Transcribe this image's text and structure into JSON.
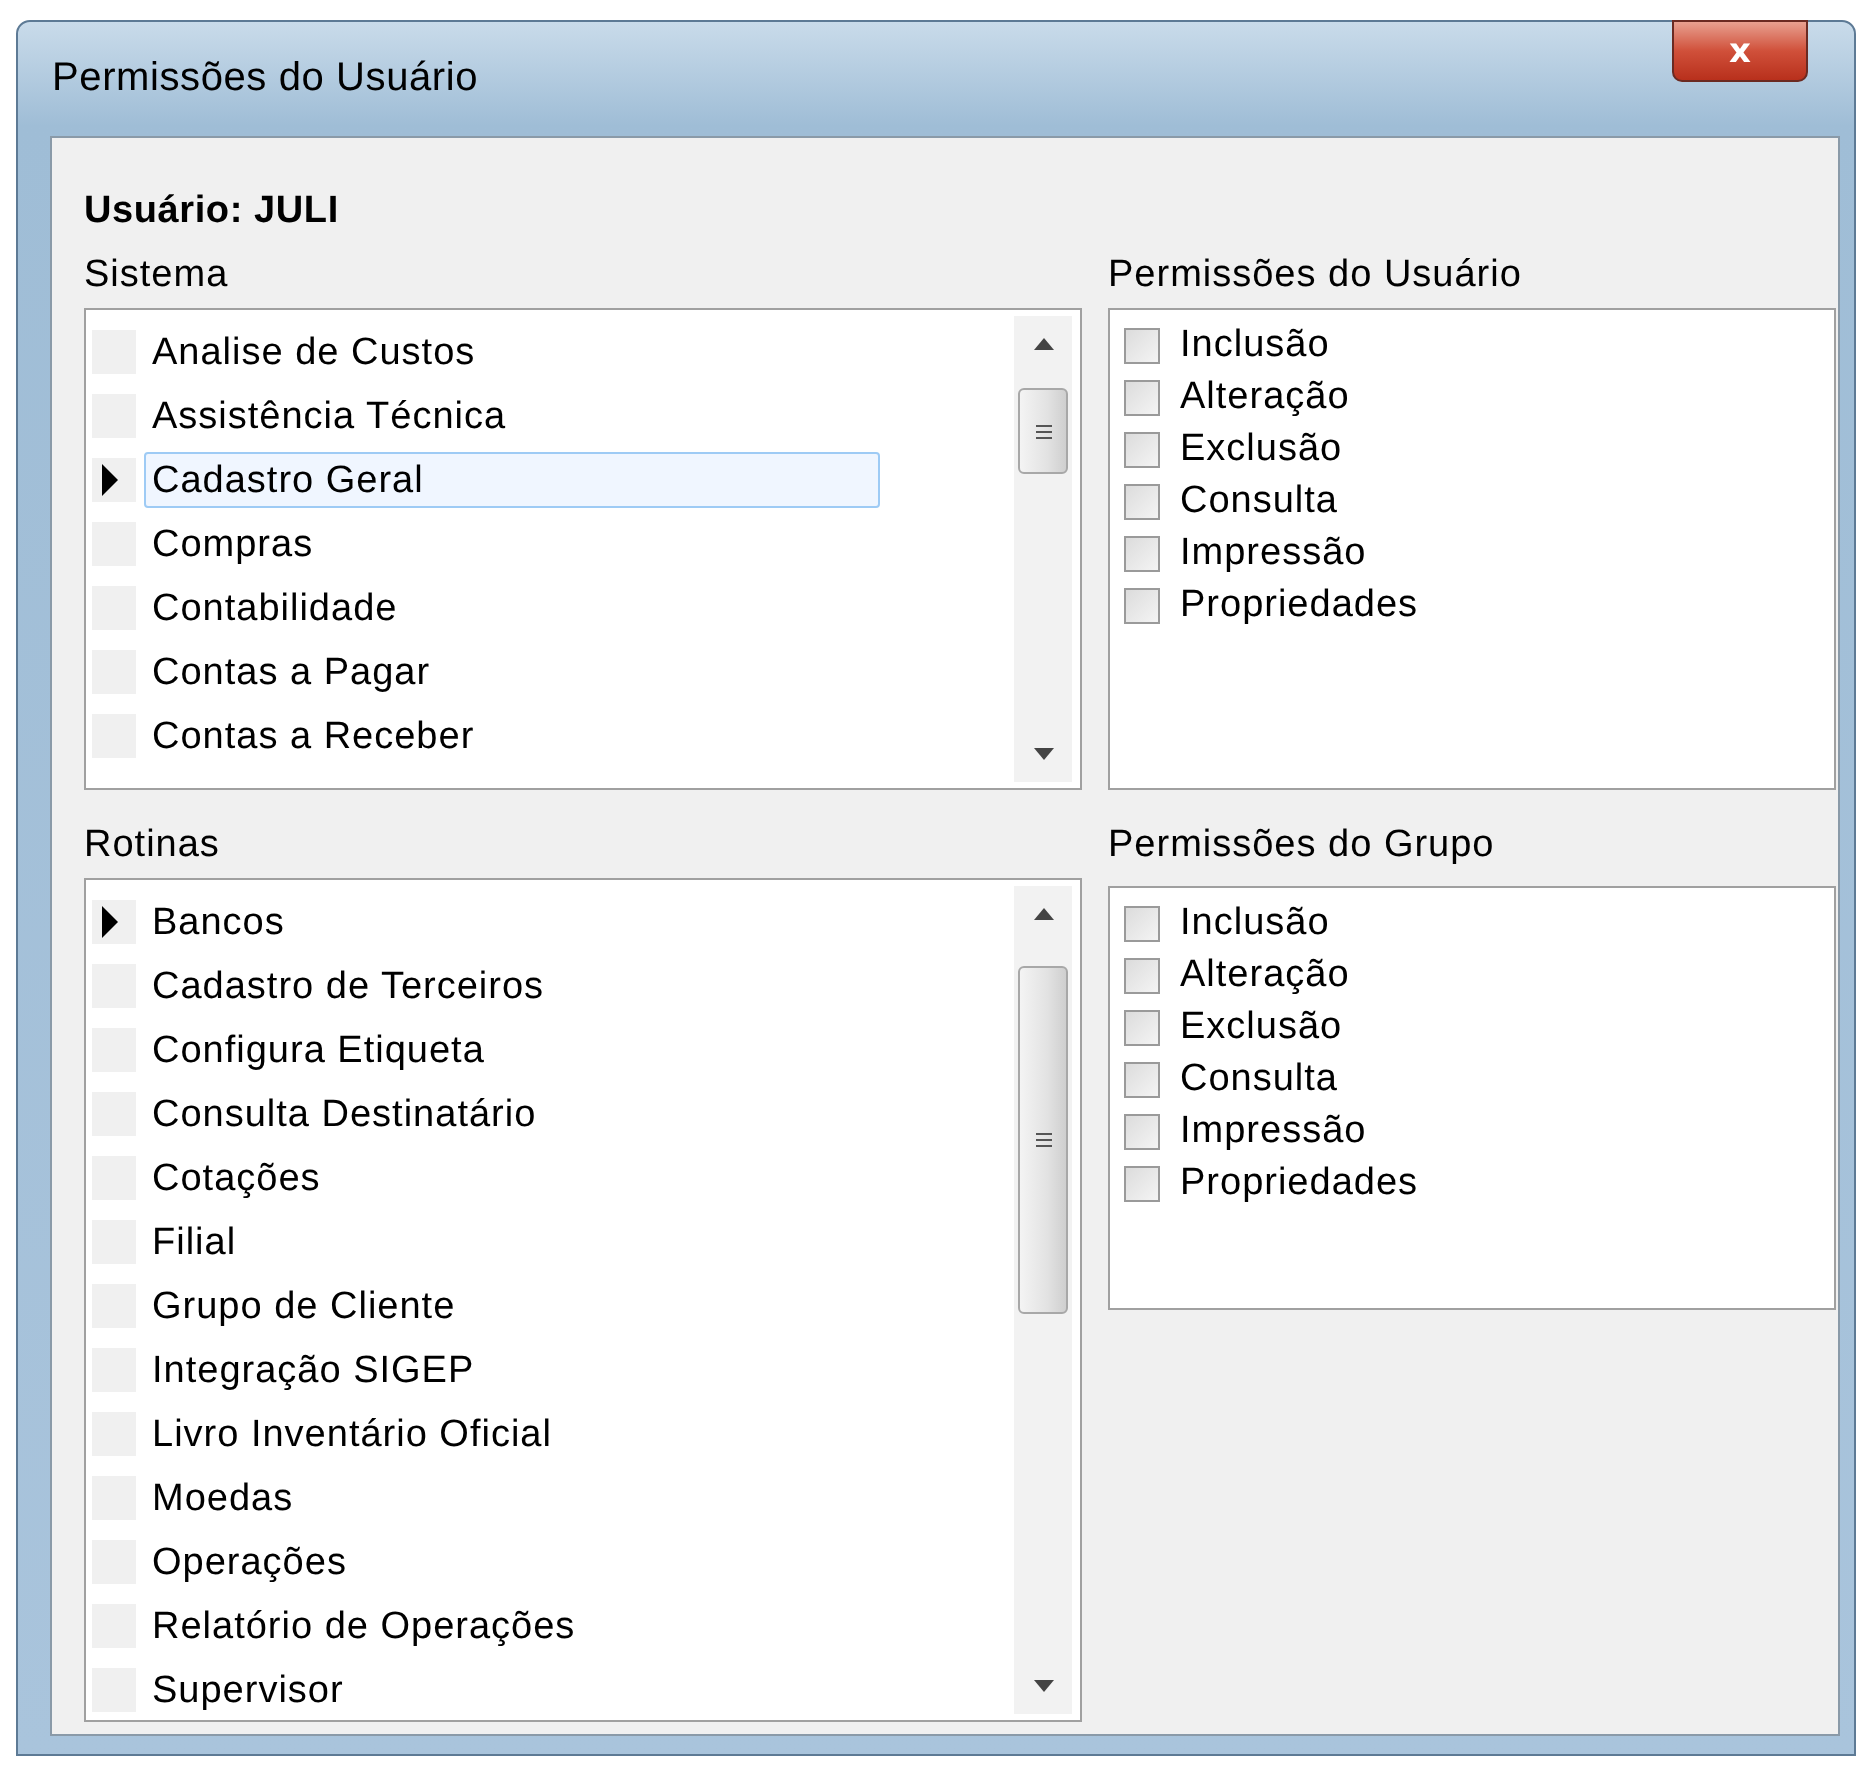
{
  "window": {
    "title": "Permissões do Usuário",
    "close_label": "x"
  },
  "user_label": "Usuário: JULI",
  "sistema": {
    "label": "Sistema",
    "items": [
      {
        "text": "Analise de Custos",
        "current": false,
        "selected": false
      },
      {
        "text": "Assistência Técnica",
        "current": false,
        "selected": false
      },
      {
        "text": "Cadastro Geral",
        "current": true,
        "selected": true
      },
      {
        "text": "Compras",
        "current": false,
        "selected": false
      },
      {
        "text": "Contabilidade",
        "current": false,
        "selected": false
      },
      {
        "text": "Contas a Pagar",
        "current": false,
        "selected": false
      },
      {
        "text": "Contas a Receber",
        "current": false,
        "selected": false
      }
    ]
  },
  "permissoes_usuario": {
    "label": "Permissões do Usuário",
    "items": [
      {
        "text": "Inclusão",
        "checked": false
      },
      {
        "text": "Alteração",
        "checked": false
      },
      {
        "text": "Exclusão",
        "checked": false
      },
      {
        "text": "Consulta",
        "checked": false
      },
      {
        "text": "Impressão",
        "checked": false
      },
      {
        "text": "Propriedades",
        "checked": false
      }
    ]
  },
  "rotinas": {
    "label": "Rotinas",
    "items": [
      {
        "text": "Bancos",
        "current": true,
        "selected": false
      },
      {
        "text": "Cadastro de Terceiros",
        "current": false,
        "selected": false
      },
      {
        "text": "Configura Etiqueta",
        "current": false,
        "selected": false
      },
      {
        "text": "Consulta Destinatário",
        "current": false,
        "selected": false
      },
      {
        "text": "Cotações",
        "current": false,
        "selected": false
      },
      {
        "text": "Filial",
        "current": false,
        "selected": false
      },
      {
        "text": "Grupo de Cliente",
        "current": false,
        "selected": false
      },
      {
        "text": "Integração SIGEP",
        "current": false,
        "selected": false
      },
      {
        "text": "Livro Inventário Oficial",
        "current": false,
        "selected": false
      },
      {
        "text": "Moedas",
        "current": false,
        "selected": false
      },
      {
        "text": "Operações",
        "current": false,
        "selected": false
      },
      {
        "text": "Relatório de Operações",
        "current": false,
        "selected": false
      },
      {
        "text": "Supervisor",
        "current": false,
        "selected": false
      }
    ]
  },
  "permissoes_grupo": {
    "label": "Permissões do Grupo",
    "items": [
      {
        "text": "Inclusão",
        "checked": false
      },
      {
        "text": "Alteração",
        "checked": false
      },
      {
        "text": "Exclusão",
        "checked": false
      },
      {
        "text": "Consulta",
        "checked": false
      },
      {
        "text": "Impressão",
        "checked": false
      },
      {
        "text": "Propriedades",
        "checked": false
      }
    ]
  }
}
